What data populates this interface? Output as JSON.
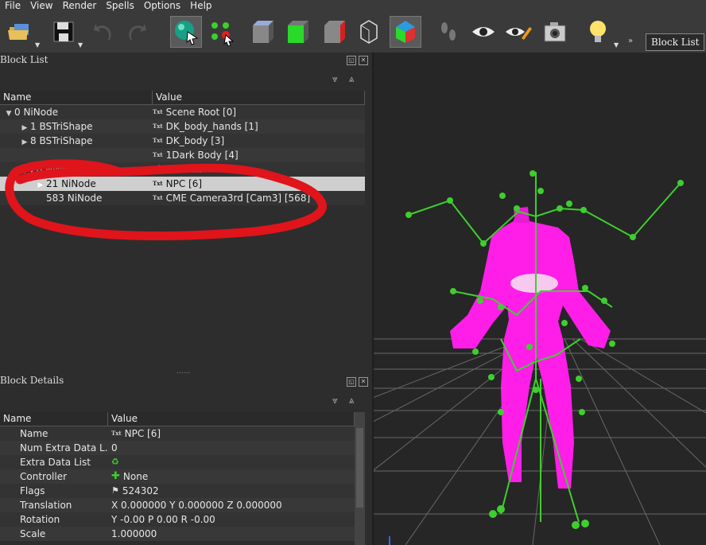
{
  "menu": [
    "File",
    "View",
    "Render",
    "Spells",
    "Options",
    "Help"
  ],
  "toolbar": {
    "overflow_chevron": "»",
    "blocklist_button": "Block List",
    "icons": [
      "open-folder-icon",
      "save-disk-icon",
      "undo-icon",
      "redo-icon",
      "select-sphere-icon",
      "bone-select-icon",
      "cube-gray-icon",
      "cube-green-icon",
      "cube-red-face-icon",
      "cube-wireframe-icon",
      "cube-colored-icon",
      "footprints-icon",
      "eye-icon",
      "eye-pencil-icon",
      "camera-icon",
      "lightbulb-icon"
    ]
  },
  "block_list": {
    "title": "Block List",
    "columns": {
      "name": "Name",
      "value": "Value"
    },
    "rows": [
      {
        "name": "0 NiNode",
        "value": "Scene Root [0]",
        "indent": 0,
        "expander": "▼",
        "txt": true
      },
      {
        "name": "1 BSTriShape",
        "value": "DK_body_hands [1]",
        "indent": 1,
        "expander": "▶",
        "txt": true
      },
      {
        "name": "8 BSTriShape",
        "value": "DK_body [3]",
        "indent": 1,
        "expander": "▶",
        "txt": true
      },
      {
        "name": "",
        "value": "1Dark Body [4]",
        "indent": 1,
        "expander": "",
        "txt": true
      },
      {
        "name": "20 NiNode",
        "value": "skeleton...",
        "indent": 1,
        "expander": "▼",
        "txt": false
      },
      {
        "name": "21 NiNode",
        "value": "NPC [6]",
        "indent": 2,
        "expander": "▶",
        "txt": true,
        "selected": true
      },
      {
        "name": "583 NiNode",
        "value": "CME Camera3rd [Cam3] [568]",
        "indent": 2,
        "expander": "",
        "txt": true
      }
    ]
  },
  "block_details": {
    "title": "Block Details",
    "columns": {
      "name": "Name",
      "value": "Value"
    },
    "rows": [
      {
        "name": "Name",
        "value": "NPC [6]",
        "icon": "txt"
      },
      {
        "name": "Num Extra Data L...",
        "value": "0",
        "icon": ""
      },
      {
        "name": "Extra Data List",
        "value": "",
        "icon": "recycle"
      },
      {
        "name": "Controller",
        "value": "None",
        "icon": "plus"
      },
      {
        "name": "Flags",
        "value": "524302",
        "icon": "flag"
      },
      {
        "name": "Translation",
        "value": "X 0.000000 Y 0.000000 Z 0.000000",
        "icon": ""
      },
      {
        "name": "Rotation",
        "value": "Y -0.00 P 0.00 R -0.00",
        "icon": ""
      },
      {
        "name": "Scale",
        "value": "1.000000",
        "icon": ""
      }
    ]
  },
  "colors": {
    "annotation": "#e0141b",
    "skeleton": "#3ecf2e",
    "mesh": "#ff1ee8",
    "grid": "#6b6b6b"
  }
}
